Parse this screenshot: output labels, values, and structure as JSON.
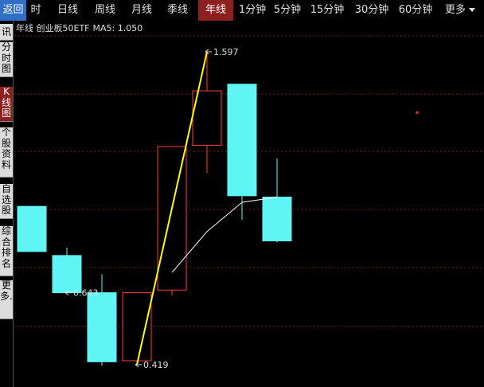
{
  "topbar": {
    "back_label": "返回",
    "tabs": [
      {
        "label": "时",
        "active": false
      },
      {
        "label": "日线",
        "active": false
      },
      {
        "label": "周线",
        "active": false
      },
      {
        "label": "月线",
        "active": false
      },
      {
        "label": "季线",
        "active": false
      },
      {
        "label": "年线",
        "active": true
      },
      {
        "label": "1分钟",
        "active": false
      },
      {
        "label": "5分钟",
        "active": false
      },
      {
        "label": "15分钟",
        "active": false
      },
      {
        "label": "30分钟",
        "active": false
      },
      {
        "label": "60分钟",
        "active": false
      },
      {
        "label": "更多",
        "active": false
      }
    ]
  },
  "sidebar": {
    "items": [
      {
        "label": "讯",
        "active": false
      },
      {
        "label": "分时图",
        "active": false
      },
      {
        "label": "K线图",
        "active": true
      },
      {
        "label": "个股资料",
        "active": false
      },
      {
        "label": "自选股",
        "active": false
      },
      {
        "label": "综合排名",
        "active": false
      },
      {
        "label": "更多..",
        "active": false
      }
    ]
  },
  "chart_header": {
    "period": "年线",
    "name": "创业板50ETF",
    "ma_label": "MA5:",
    "ma_value": "1.050"
  },
  "colors": {
    "up": "#ff3b3b",
    "down": "#5ff5f5",
    "ma": "#ffffff",
    "trend": "#ffff00",
    "grid": "#7a1515"
  },
  "chart_data": {
    "type": "candlestick",
    "candles": [
      {
        "open": 1.015,
        "close": 0.845,
        "high": 1.015,
        "low": 0.845
      },
      {
        "open": 0.83,
        "close": 0.69,
        "high": 0.86,
        "low": 0.69
      },
      {
        "open": 0.69,
        "close": 0.43,
        "high": 0.76,
        "low": 0.415
      },
      {
        "open": 0.434,
        "close": 0.69,
        "high": 0.69,
        "low": 0.419
      },
      {
        "open": 0.7,
        "close": 1.24,
        "high": 1.24,
        "low": 0.68
      },
      {
        "open": 1.245,
        "close": 1.45,
        "high": 1.597,
        "low": 1.14
      },
      {
        "open": 1.475,
        "close": 1.055,
        "high": 1.475,
        "low": 0.965
      },
      {
        "open": 1.05,
        "close": 0.885,
        "high": 1.195,
        "low": 0.88
      }
    ],
    "ma5": [
      null,
      null,
      null,
      null,
      0.766,
      0.92,
      1.03,
      1.05
    ],
    "annotations": [
      {
        "label": "1.597",
        "candle": 5,
        "value": 1.597
      },
      {
        "label": "0.419",
        "candle": 3,
        "value": 0.419
      },
      {
        "label": "0.643",
        "candle": 1,
        "value": 0.69
      }
    ],
    "trendline": {
      "from": {
        "candle": 3,
        "value": 0.419
      },
      "to": {
        "candle": 5,
        "value": 1.597
      }
    },
    "marker": {
      "candle": 11,
      "value": 1.368
    }
  }
}
